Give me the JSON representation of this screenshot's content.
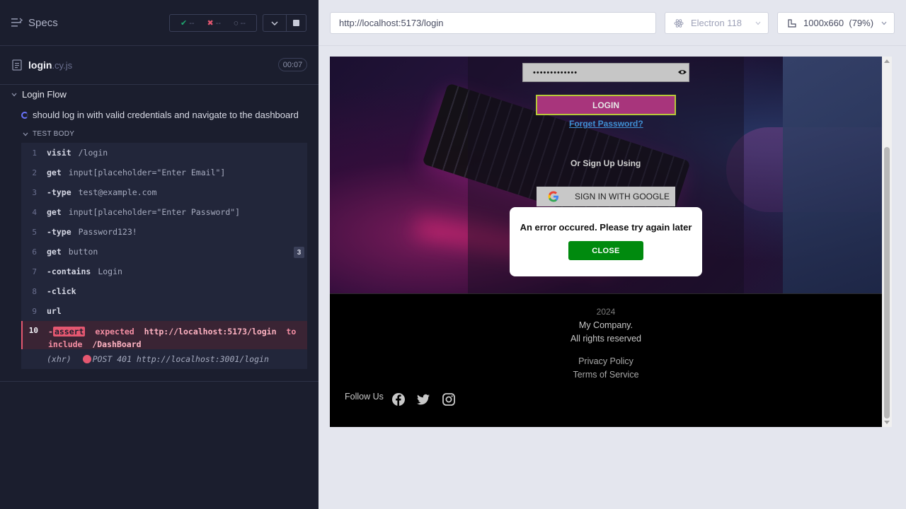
{
  "reporter": {
    "specs_label": "Specs",
    "stats": {
      "passed": "--",
      "failed": "--",
      "pending": "--"
    },
    "file": {
      "name": "login",
      "ext": ".cy.js",
      "duration": "00:07"
    },
    "suite_title": "Login Flow",
    "test_title": "should log in with valid credentials and navigate to the dashboard",
    "test_body_label": "TEST BODY",
    "commands": [
      {
        "num": "1",
        "name": "visit",
        "msg": "/login"
      },
      {
        "num": "2",
        "name": "get",
        "msg": "input[placeholder=\"Enter Email\"]"
      },
      {
        "num": "3",
        "name": "-type",
        "msg": "test@example.com"
      },
      {
        "num": "4",
        "name": "get",
        "msg": "input[placeholder=\"Enter Password\"]"
      },
      {
        "num": "5",
        "name": "-type",
        "msg": "Password123!"
      },
      {
        "num": "6",
        "name": "get",
        "msg": "button",
        "badge": "3"
      },
      {
        "num": "7",
        "name": "-contains",
        "msg": "Login"
      },
      {
        "num": "8",
        "name": "-click",
        "msg": ""
      },
      {
        "num": "9",
        "name": "url",
        "msg": ""
      }
    ],
    "failed_command": {
      "num": "10",
      "prefix": "-",
      "tag": "assert",
      "word_expected": "expected",
      "actual_url": "http://localhost:5173/login",
      "word_to_include": "to include",
      "expected_path": "/DashBoard"
    },
    "xhr": {
      "label": "(xhr)",
      "msg": "POST 401 http://localhost:3001/login"
    }
  },
  "toolbar": {
    "url": "http://localhost:5173/login",
    "browser": "Electron 118",
    "viewport": "1000x660",
    "zoom": "(79%)"
  },
  "app": {
    "password_mask": "•••••••••••••",
    "login_label": "LOGIN",
    "forgot_label": "Forget Password?",
    "or_sign_up": "Or Sign Up Using",
    "google_label": "SIGN IN WITH GOOGLE",
    "error_message": "An error occured. Please try again later",
    "close_label": "CLOSE",
    "footer": {
      "year": "2024",
      "company": "My Company.",
      "rights": "All rights reserved",
      "privacy": "Privacy Policy",
      "terms": "Terms of Service",
      "follow": "Follow Us"
    }
  },
  "colors": {
    "reporter_bg": "#1b1e2e",
    "failed_accent": "#e45770",
    "login_button": "#a8357c",
    "close_button": "#008a0e"
  }
}
